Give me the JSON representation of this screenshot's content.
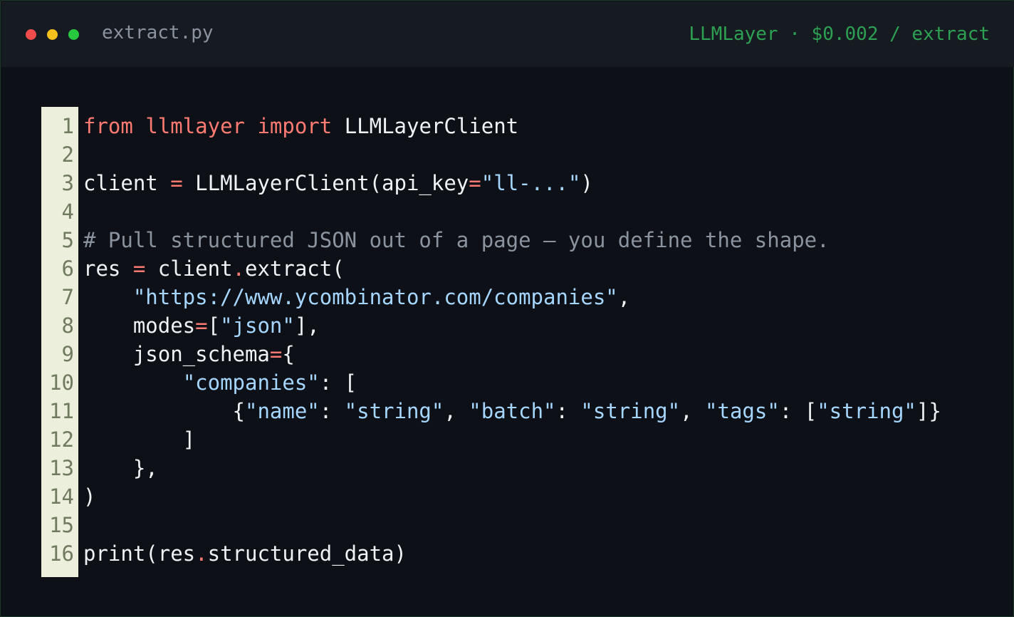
{
  "window": {
    "filename": "extract.py",
    "meta": "LLMLayer · $0.002 / extract",
    "controls": [
      "close",
      "minimize",
      "maximize"
    ]
  },
  "colors": {
    "background": "#0d1117",
    "titlebar": "#161b22",
    "gutter": "#ecefdc",
    "line_number": "#707a5e",
    "keyword": "#ff7b72",
    "string": "#a5d6ff",
    "comment": "#8b949e",
    "text": "#f0f3f6",
    "meta": "#2ea052"
  },
  "code": {
    "language": "python",
    "lines": [
      {
        "n": "1",
        "tokens": [
          {
            "t": "kw",
            "v": "from"
          },
          {
            "t": "plain",
            "v": " "
          },
          {
            "t": "kw",
            "v": "llmlayer"
          },
          {
            "t": "plain",
            "v": " "
          },
          {
            "t": "kw",
            "v": "import"
          },
          {
            "t": "plain",
            "v": " LLMLayerClient"
          }
        ]
      },
      {
        "n": "2",
        "tokens": []
      },
      {
        "n": "3",
        "tokens": [
          {
            "t": "plain",
            "v": "client "
          },
          {
            "t": "op",
            "v": "="
          },
          {
            "t": "plain",
            "v": " LLMLayerClient(api_key"
          },
          {
            "t": "op",
            "v": "="
          },
          {
            "t": "str",
            "v": "\"ll-...\""
          },
          {
            "t": "plain",
            "v": ")"
          }
        ]
      },
      {
        "n": "4",
        "tokens": []
      },
      {
        "n": "5",
        "tokens": [
          {
            "t": "com",
            "v": "# Pull structured JSON out of a page — you define the shape."
          }
        ]
      },
      {
        "n": "6",
        "tokens": [
          {
            "t": "plain",
            "v": "res "
          },
          {
            "t": "op",
            "v": "="
          },
          {
            "t": "plain",
            "v": " client"
          },
          {
            "t": "op",
            "v": "."
          },
          {
            "t": "plain",
            "v": "extract("
          }
        ]
      },
      {
        "n": "7",
        "tokens": [
          {
            "t": "plain",
            "v": "    "
          },
          {
            "t": "str",
            "v": "\"https://www.ycombinator.com/companies\""
          },
          {
            "t": "plain",
            "v": ","
          }
        ]
      },
      {
        "n": "8",
        "tokens": [
          {
            "t": "plain",
            "v": "    modes"
          },
          {
            "t": "op",
            "v": "="
          },
          {
            "t": "plain",
            "v": "["
          },
          {
            "t": "str",
            "v": "\"json\""
          },
          {
            "t": "plain",
            "v": "],"
          }
        ]
      },
      {
        "n": "9",
        "tokens": [
          {
            "t": "plain",
            "v": "    json_schema"
          },
          {
            "t": "op",
            "v": "="
          },
          {
            "t": "plain",
            "v": "{"
          }
        ]
      },
      {
        "n": "10",
        "tokens": [
          {
            "t": "plain",
            "v": "        "
          },
          {
            "t": "str",
            "v": "\"companies\""
          },
          {
            "t": "plain",
            "v": ": ["
          }
        ]
      },
      {
        "n": "11",
        "tokens": [
          {
            "t": "plain",
            "v": "            {"
          },
          {
            "t": "str",
            "v": "\"name\""
          },
          {
            "t": "plain",
            "v": ": "
          },
          {
            "t": "str",
            "v": "\"string\""
          },
          {
            "t": "plain",
            "v": ", "
          },
          {
            "t": "str",
            "v": "\"batch\""
          },
          {
            "t": "plain",
            "v": ": "
          },
          {
            "t": "str",
            "v": "\"string\""
          },
          {
            "t": "plain",
            "v": ", "
          },
          {
            "t": "str",
            "v": "\"tags\""
          },
          {
            "t": "plain",
            "v": ": ["
          },
          {
            "t": "str",
            "v": "\"string\""
          },
          {
            "t": "plain",
            "v": "]}"
          }
        ]
      },
      {
        "n": "12",
        "tokens": [
          {
            "t": "plain",
            "v": "        ]"
          }
        ]
      },
      {
        "n": "13",
        "tokens": [
          {
            "t": "plain",
            "v": "    },"
          }
        ]
      },
      {
        "n": "14",
        "tokens": [
          {
            "t": "plain",
            "v": ")"
          }
        ]
      },
      {
        "n": "15",
        "tokens": []
      },
      {
        "n": "16",
        "tokens": [
          {
            "t": "plain",
            "v": "print(res"
          },
          {
            "t": "op",
            "v": "."
          },
          {
            "t": "plain",
            "v": "structured_data)"
          }
        ]
      }
    ]
  }
}
